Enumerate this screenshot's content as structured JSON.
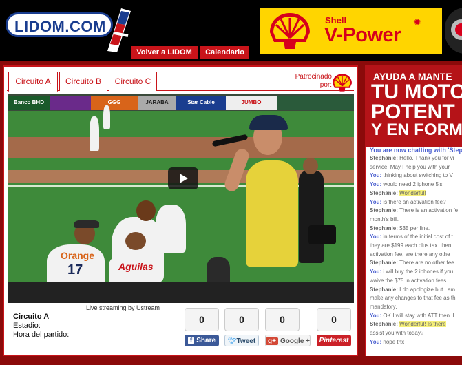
{
  "header": {
    "logo_text": "LIDOM.COM",
    "nav": [
      {
        "label": "Volver a LIDOM"
      },
      {
        "label": "Calendario"
      }
    ],
    "ad": {
      "brand": "Shell",
      "product": "V-Power"
    }
  },
  "player": {
    "tabs": [
      {
        "label": "Circuito A",
        "active": true
      },
      {
        "label": "Circuito B",
        "active": false
      },
      {
        "label": "Circuito C",
        "active": false
      }
    ],
    "sponsor_label": "Patrocinado por:",
    "video": {
      "banners": [
        "Banco BHD",
        "GGG",
        "JARABA",
        "Star Cable",
        "JUMBO"
      ],
      "jersey_1": "Orange",
      "jersey_1_number": "17",
      "jersey_2": "Aguilas"
    },
    "ustream_link": "Live streaming by Ustream",
    "info": {
      "title": "Circuito A",
      "estadio": "Estadio:",
      "hora": "Hora del partido:"
    },
    "share": {
      "facebook": {
        "count": "0",
        "label": "Share"
      },
      "twitter": {
        "count": "0",
        "label": "Tweet"
      },
      "google": {
        "count": "0",
        "label": "Google +"
      },
      "pinterest": {
        "count": "0",
        "label": "Pinterest"
      }
    }
  },
  "right_ad": {
    "line1": "AYUDA A MANTE",
    "line2": "TU MOTO",
    "line3": "POTENT",
    "line4": "Y EN FORM"
  },
  "chat": {
    "header": "You are now chatting with 'Steph",
    "lines": [
      {
        "who": "Stephanie:",
        "text": "Hello. Thank you for vi",
        "you": false
      },
      {
        "who": "",
        "text": "service.  May I help you with your",
        "you": false
      },
      {
        "who": "You:",
        "text": "thinking about switching to V",
        "you": true
      },
      {
        "who": "You:",
        "text": "would need 2 iphone 5's",
        "you": true
      },
      {
        "who": "Stephanie:",
        "text": "Wonderful!",
        "you": false,
        "hl": true
      },
      {
        "who": "You:",
        "text": "is there an activation fee?",
        "you": true
      },
      {
        "who": "Stephanie:",
        "text": "There is an activation fe",
        "you": false
      },
      {
        "who": "",
        "text": "month's bill.",
        "you": false
      },
      {
        "who": "Stephanie:",
        "text": "$35 per line.",
        "you": false
      },
      {
        "who": "You:",
        "text": "in terms of the initial cost of t",
        "you": true
      },
      {
        "who": "",
        "text": "they are $199 each plus tax. then",
        "you": true
      },
      {
        "who": "",
        "text": "activation fee, are there any othe",
        "you": true
      },
      {
        "who": "Stephanie:",
        "text": "There are no other fee",
        "you": false
      },
      {
        "who": "You:",
        "text": "i will buy the 2 iphones if you",
        "you": true
      },
      {
        "who": "",
        "text": "waive the $75 in activation fees.",
        "you": true
      },
      {
        "who": "Stephanie:",
        "text": "I do apologize but I am",
        "you": false
      },
      {
        "who": "",
        "text": "make any changes to that fee as th",
        "you": false
      },
      {
        "who": "",
        "text": "mandatory.",
        "you": false
      },
      {
        "who": "You:",
        "text": "OK I will stay with ATT then. I",
        "you": true
      },
      {
        "who": "Stephanie:",
        "text": "Wonderful! Is there",
        "you": false,
        "hl": true
      },
      {
        "who": "",
        "text": "assist you with today?",
        "you": false
      },
      {
        "who": "You:",
        "text": "nope thx",
        "you": true
      }
    ]
  }
}
